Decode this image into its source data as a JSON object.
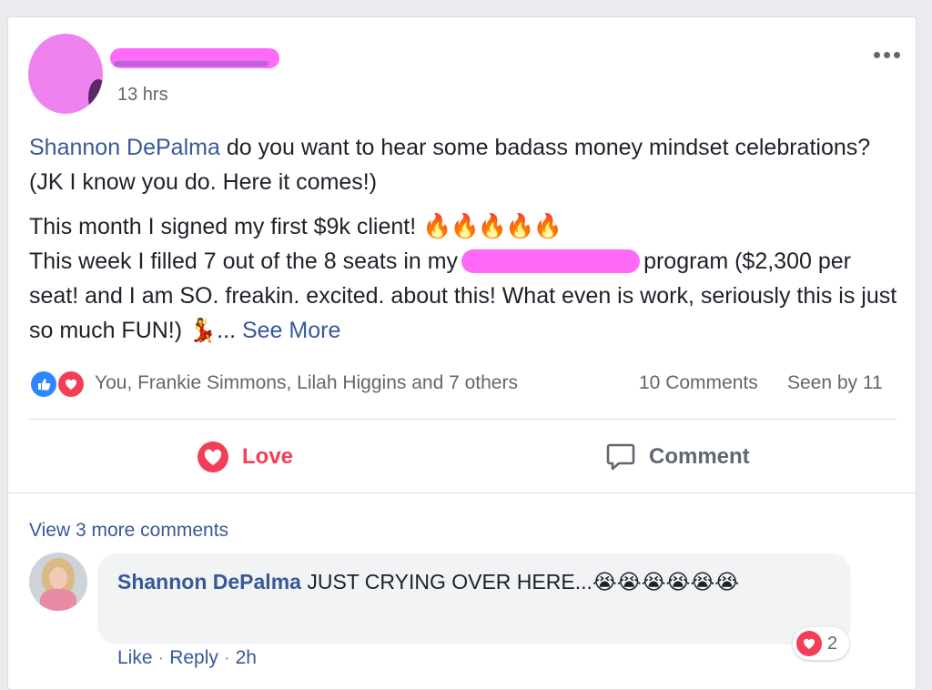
{
  "post": {
    "timestamp": "13 hrs",
    "mention": "Shannon DePalma",
    "intro": " do you want to hear some badass money mindset celebrations? (JK I know you do. Here it comes!)",
    "line1": "This month I signed my first $9k client! ",
    "flames": "🔥🔥🔥🔥🔥",
    "line2_pre": "This week I filled 7 out of the 8 seats in my",
    "line2_post": "program ($2,300 per seat! and I am SO. freakin. excited. about this! What even is work, seriously this is just so much FUN!) ",
    "dancer": "💃",
    "ellipsis": "... ",
    "see_more": "See More"
  },
  "reactions": {
    "names": "You, Frankie Simmons, Lilah Higgins and 7 others",
    "comments": "10 Comments",
    "seen": "Seen by 11"
  },
  "actions": {
    "love": "Love",
    "comment": "Comment"
  },
  "comments": {
    "view_more": "View 3 more comments",
    "items": [
      {
        "author": "Shannon DePalma",
        "text": " JUST CRYING OVER HERE...",
        "emojis": "😭😭😭😭😭😭",
        "like": "Like",
        "reply": "Reply",
        "time": "2h",
        "reaction_count": "2"
      }
    ]
  },
  "colors": {
    "link": "#385898",
    "love": "#f33e58",
    "like": "#2d88ff",
    "redaction": "#ff6af7"
  }
}
